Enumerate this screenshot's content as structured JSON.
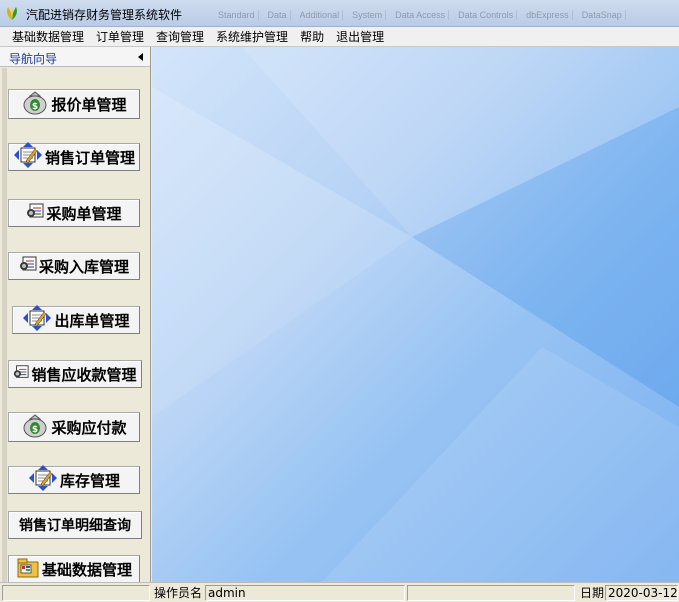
{
  "window": {
    "title": "汽配进销存财务管理系统软件",
    "ghost_toolbar": [
      "Standard",
      "Data",
      "Additional",
      "System",
      "Data Access",
      "Data Controls",
      "dbExpress",
      "DataSnap"
    ]
  },
  "menu": {
    "items": [
      "基础数据管理",
      "订单管理",
      "查询管理",
      "系统维护管理",
      "帮助",
      "退出管理"
    ]
  },
  "sidebar": {
    "title": "导航向导",
    "buttons": [
      {
        "label": "报价单管理",
        "icon": "money-bag-icon"
      },
      {
        "label": "销售订单管理",
        "icon": "notebook-pencil-icon"
      },
      {
        "label": "采购单管理",
        "icon": "form-icon"
      },
      {
        "label": "采购入库管理",
        "icon": "form-icon"
      },
      {
        "label": "出库单管理",
        "icon": "notebook-pencil-icon"
      },
      {
        "label": "销售应收款管理",
        "icon": "form-icon"
      },
      {
        "label": "采购应付款",
        "icon": "money-bag-icon"
      },
      {
        "label": "库存管理",
        "icon": "notebook-pencil-icon"
      },
      {
        "label": "销售订单明细查询",
        "icon": ""
      },
      {
        "label": "基础数据管理",
        "icon": "folder-data-icon"
      }
    ]
  },
  "statusbar": {
    "operator_label": "操作员名",
    "operator_value": "admin",
    "date_label": "日期",
    "date_value": "2020-03-12"
  },
  "colors": {
    "workspace_light": "#d3e5fa",
    "workspace_dark": "#6ba7ef",
    "sidebar_title": "#1a3c9c"
  }
}
